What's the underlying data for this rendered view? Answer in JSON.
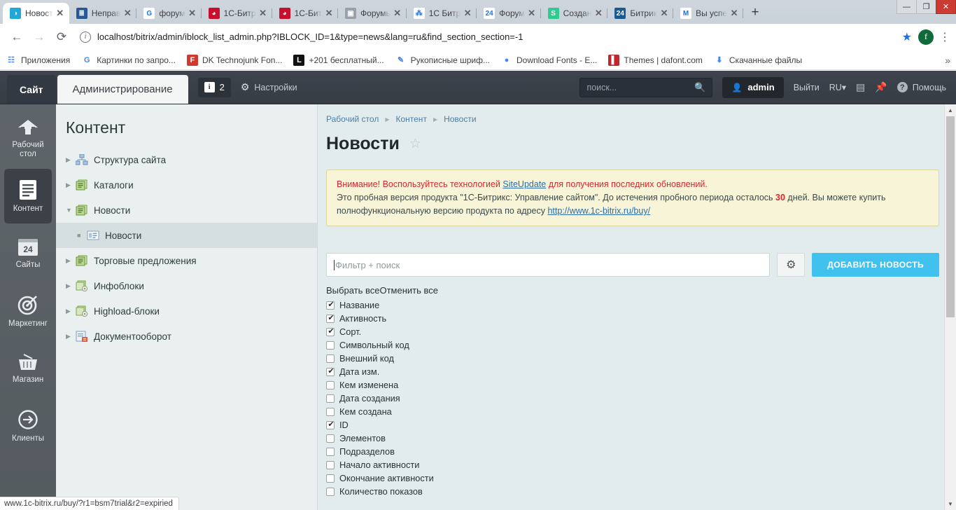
{
  "browser": {
    "tabs": [
      {
        "title": "Новост",
        "icon": "bitrix-icon",
        "icon_char": "◑",
        "icon_bg": "#1fa8d8",
        "active": true
      },
      {
        "title": "Неправ",
        "icon": "book-icon",
        "icon_char": "≣",
        "icon_bg": "#2b5797",
        "active": false
      },
      {
        "title": "форум",
        "icon": "google-icon",
        "icon_char": "G",
        "icon_bg": "#ffffff",
        "active": false
      },
      {
        "title": "1С-Битр",
        "icon": "bitrix-red-icon",
        "icon_char": "◕",
        "icon_bg": "#c8102e",
        "active": false
      },
      {
        "title": "1С-Бит",
        "icon": "bitrix-red-icon",
        "icon_char": "◕",
        "icon_bg": "#c8102e",
        "active": false
      },
      {
        "title": "Форумь",
        "icon": "forum-icon",
        "icon_char": "▣",
        "icon_bg": "#9aa0a6",
        "active": false
      },
      {
        "title": "1С Битр",
        "icon": "network-icon",
        "icon_char": "⁂",
        "icon_bg": "#ffffff",
        "active": false
      },
      {
        "title": "Форум",
        "icon": "bitrix24-icon",
        "icon_char": "24",
        "icon_bg": "#ffffff",
        "active": false
      },
      {
        "title": "Создан",
        "icon": "sheets-icon",
        "icon_char": "S",
        "icon_bg": "#2ecc8f",
        "active": false
      },
      {
        "title": "Битрик",
        "icon": "bitrix24-blue-icon",
        "icon_char": "24",
        "icon_bg": "#1c5b91",
        "active": false
      },
      {
        "title": "Вы успе",
        "icon": "gmail-icon",
        "icon_char": "M",
        "icon_bg": "#ffffff",
        "active": false
      }
    ],
    "newtab_label": "+",
    "window_buttons": {
      "minimize": "—",
      "maximize": "❐",
      "close": "✕"
    },
    "nav": {
      "back": "←",
      "forward": "→",
      "reload": "⟳"
    },
    "url": "localhost/bitrix/admin/iblock_list_admin.php?IBLOCK_ID=1&type=news&lang=ru&find_section_section=-1",
    "profile_initial": "f",
    "bookmarks": [
      {
        "label": "Приложения",
        "icon": "apps-grid-icon",
        "icon_char": "☷",
        "icon_bg": "#ffffff"
      },
      {
        "label": "Картинки по запро...",
        "icon": "google-icon",
        "icon_char": "G",
        "icon_bg": "#ffffff"
      },
      {
        "label": "DK Technojunk Fon...",
        "icon": "fontsquirrel-icon",
        "icon_char": "F",
        "icon_bg": "#d03a2e"
      },
      {
        "label": "+201 бесплатный...",
        "icon": "letter-l-icon",
        "icon_char": "L",
        "icon_bg": "#111111"
      },
      {
        "label": "Рукописные шриф...",
        "icon": "pen-icon",
        "icon_char": "✎",
        "icon_bg": "#ffffff"
      },
      {
        "label": "Download Fonts - E...",
        "icon": "leaf-icon",
        "icon_char": "●",
        "icon_bg": "#ffffff"
      },
      {
        "label": "Themes | dafont.com",
        "icon": "dafont-icon",
        "icon_char": "▌",
        "icon_bg": "#c0272d"
      },
      {
        "label": "Скачанные файлы",
        "icon": "download-icon",
        "icon_char": "⬇",
        "icon_bg": "#ffffff"
      }
    ],
    "bookmarks_overflow": "»",
    "status_text": "www.1c-bitrix.ru/buy/?r1=bsm7trial&r2=expiried"
  },
  "admin_header": {
    "tab_site": "Сайт",
    "tab_admin": "Администрирование",
    "counter_value": "2",
    "counter_icon": "i",
    "settings_label": "Настройки",
    "settings_icon": "gear-icon",
    "search_placeholder": "поиск...",
    "search_icon": "search-icon",
    "user_name": "admin",
    "user_icon": "person-icon",
    "logout_label": "Выйти",
    "language_label": "RU",
    "language_caret": "▾",
    "keyboard_icon": "keyboard-icon",
    "pin_icon": "pin-icon",
    "help_label": "Помощь",
    "help_icon": "question-icon"
  },
  "left_rail": [
    {
      "label": "Рабочий стол",
      "icon": "home-icon",
      "active": false
    },
    {
      "label": "Контент",
      "icon": "document-icon",
      "active": true
    },
    {
      "label": "Сайты",
      "icon": "bitrix24-window-icon",
      "active": false
    },
    {
      "label": "Маркетинг",
      "icon": "target-icon",
      "active": false
    },
    {
      "label": "Магазин",
      "icon": "basket-icon",
      "active": false
    },
    {
      "label": "Клиенты",
      "icon": "arrow-circle-icon",
      "active": false
    }
  ],
  "menu_pane": {
    "title": "Контент",
    "items": [
      {
        "label": "Структура сайта",
        "icon": "sitemap-icon",
        "arrow": "▶",
        "level": 0,
        "selected": false
      },
      {
        "label": "Каталоги",
        "icon": "iblock-icon",
        "arrow": "▶",
        "level": 0,
        "selected": false
      },
      {
        "label": "Новости",
        "icon": "iblock-icon",
        "arrow": "▼",
        "level": 0,
        "selected": false
      },
      {
        "label": "Новости",
        "icon": "list-icon",
        "arrow": "",
        "level": 1,
        "selected": true
      },
      {
        "label": "Торговые предложения",
        "icon": "iblock-icon",
        "arrow": "▶",
        "level": 0,
        "selected": false
      },
      {
        "label": "Инфоблоки",
        "icon": "iblock-gear-icon",
        "arrow": "▶",
        "level": 0,
        "selected": false
      },
      {
        "label": "Highload-блоки",
        "icon": "iblock-gear-icon",
        "arrow": "▶",
        "level": 0,
        "selected": false
      },
      {
        "label": "Документооборот",
        "icon": "docflow-icon",
        "arrow": "▶",
        "level": 0,
        "selected": false
      }
    ]
  },
  "content": {
    "breadcrumbs": [
      "Рабочий стол",
      "Контент",
      "Новости"
    ],
    "breadcrumb_sep": "▶",
    "page_title": "Новости",
    "favorite_icon": "star-outline-icon",
    "notice": {
      "line1_warn": "Внимание!",
      "line1_pre": " Воспользуйтесь технологией ",
      "line1_link": "SiteUpdate",
      "line1_post": " для получения последних обновлений.",
      "line2_pre": "Это пробная версия продукта \"1С-Битрикс: Управление сайтом\". До истечения пробного периода осталось ",
      "line2_days": "30",
      "line2_post": " дней. Вы можете купить полнофункциональную версию продукта по адресу ",
      "line2_link": "http://www.1c-bitrix.ru/buy/"
    },
    "filter_placeholder": "Фильтр + поиск",
    "filter_value": "",
    "settings_gear_icon": "gear-icon",
    "add_button_label": "ДОБАВИТЬ НОВОСТЬ",
    "select_all_label": "Выбрать все",
    "deselect_all_label": "Отменить все",
    "columns": [
      {
        "label": "Название",
        "checked": true
      },
      {
        "label": "Активность",
        "checked": true
      },
      {
        "label": "Сорт.",
        "checked": true
      },
      {
        "label": "Символьный код",
        "checked": false
      },
      {
        "label": "Внешний код",
        "checked": false
      },
      {
        "label": "Дата изм.",
        "checked": true
      },
      {
        "label": "Кем изменена",
        "checked": false
      },
      {
        "label": "Дата создания",
        "checked": false
      },
      {
        "label": "Кем создана",
        "checked": false
      },
      {
        "label": "ID",
        "checked": true
      },
      {
        "label": "Элементов",
        "checked": false
      },
      {
        "label": "Подразделов",
        "checked": false
      },
      {
        "label": "Начало активности",
        "checked": false
      },
      {
        "label": "Окончание активности",
        "checked": false
      },
      {
        "label": "Количество показов",
        "checked": false
      }
    ]
  },
  "colors": {
    "accent_blue": "#41c1ee",
    "header_dark": "#3a4049",
    "rail_gray": "#596065",
    "page_bg": "#e3ecec",
    "notice_bg": "#f7f4d8",
    "warn_red": "#d9262e",
    "link_blue": "#2c6ca8"
  }
}
